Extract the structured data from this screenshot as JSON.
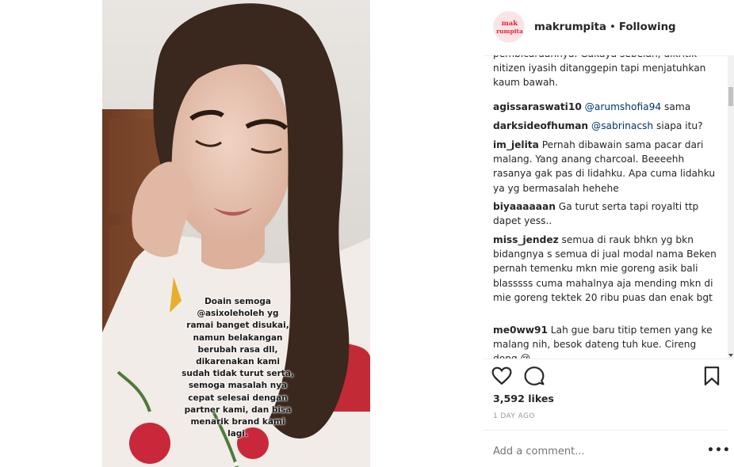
{
  "post": {
    "username": "makrumpita",
    "separator": "•",
    "follow_status": "Following",
    "avatar_text_top": "mak",
    "avatar_text_bottom": "rumpita"
  },
  "story_caption": [
    "Doain semoga",
    "@asixoleholeh yg",
    "ramai banget disukai,",
    "namun belakangan",
    "berubah rasa dll,",
    "dikarenakan kami",
    "sudah tidak turut serta,",
    "semoga masalah nya",
    "cepat selesai dengan",
    "partner kami, dan bisa",
    "menarik brand kami",
    "lagi."
  ],
  "comments": {
    "c0": {
      "text": "pembicaraannya. Gakaya sebelah, dikritik nitizen iyasih ditanggepin tapi menjatuhkan kaum bawah."
    },
    "c1": {
      "user": "agissaraswati10",
      "mention": "@arumshofia94",
      "text": " sama"
    },
    "c2": {
      "user": "darksideofhuman",
      "mention": "@sabrinacsh",
      "text": " siapa itu?"
    },
    "c3": {
      "user": "im_jelita",
      "text": " Pernah dibawain sama pacar dari malang. Yang anang charcoal. Beeeehh rasanya gak pas di lidahku. Apa cuma lidahku ya yg bermasalah hehehe"
    },
    "c4": {
      "user": "biyaaaaaan",
      "text": " Ga turut serta tapi royalti ttp dapet yess.."
    },
    "c5": {
      "user": "miss_jendez",
      "text": " semua di rauk bhkn yg bkn bidangnya s semua di jual modal nama Beken pernah temenku mkn mie goreng asik bali blasssss cuma mahalnya aja mending mkn di mie goreng tektek 20 ribu puas dan enak bgt"
    },
    "c6": {
      "user": "me0ww91",
      "text": " Lah gue baru titip temen yang ke malang nih, besok dateng tuh kue. Cireng dong 😢"
    }
  },
  "likes": "3,592 likes",
  "time_ago": "1 DAY AGO",
  "add_comment_placeholder": "Add a comment...",
  "more_label": "•••",
  "icons": {
    "like": "heart-icon",
    "comment": "comment-icon",
    "save": "bookmark-icon"
  },
  "colors": {
    "text": "#262626",
    "mention": "#003569",
    "muted": "#999999",
    "divider": "#efefef",
    "brand": "#e0243b"
  }
}
